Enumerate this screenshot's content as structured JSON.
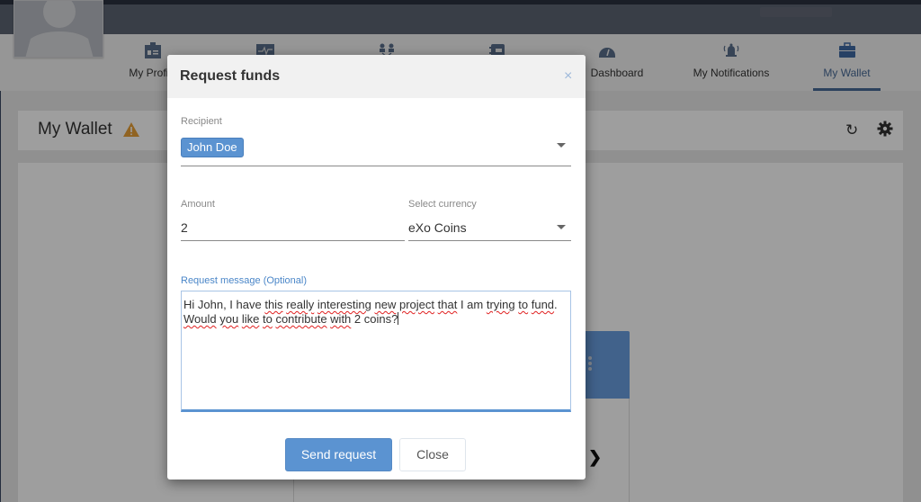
{
  "nav": {
    "items": [
      {
        "label": "My Profile",
        "icon": "profile-badge-icon"
      },
      {
        "label": "",
        "icon": "activity-icon"
      },
      {
        "label": "",
        "icon": "network-icon"
      },
      {
        "label": "",
        "icon": "contacts-icon"
      },
      {
        "label": "Dashboard",
        "icon": "dashboard-gauge-icon"
      },
      {
        "label": "My Notifications",
        "icon": "bell-icon"
      },
      {
        "label": "My Wallet",
        "icon": "briefcase-icon",
        "active": true
      }
    ],
    "visible_profile_label": "My Prof"
  },
  "page": {
    "title": "My Wallet",
    "warning_icon": "warning-icon",
    "refresh_icon": "refresh-icon",
    "settings_icon": "gear-icon"
  },
  "colors": {
    "accent": "#5b93d1",
    "nav_active": "#476a96",
    "warning": "#e8a038"
  },
  "modal": {
    "title": "Request funds",
    "close_icon": "×",
    "recipient": {
      "label": "Recipient",
      "selected_chip": "John Doe"
    },
    "amount": {
      "label": "Amount",
      "value": "2"
    },
    "currency": {
      "label": "Select currency",
      "value": "eXo Coins"
    },
    "message": {
      "label": "Request message (Optional)",
      "value": "Hi John, I have this really interesting new project that I am trying to fund. Would you like to contribute with 2 coins?"
    },
    "buttons": {
      "send": "Send request",
      "close": "Close"
    }
  }
}
